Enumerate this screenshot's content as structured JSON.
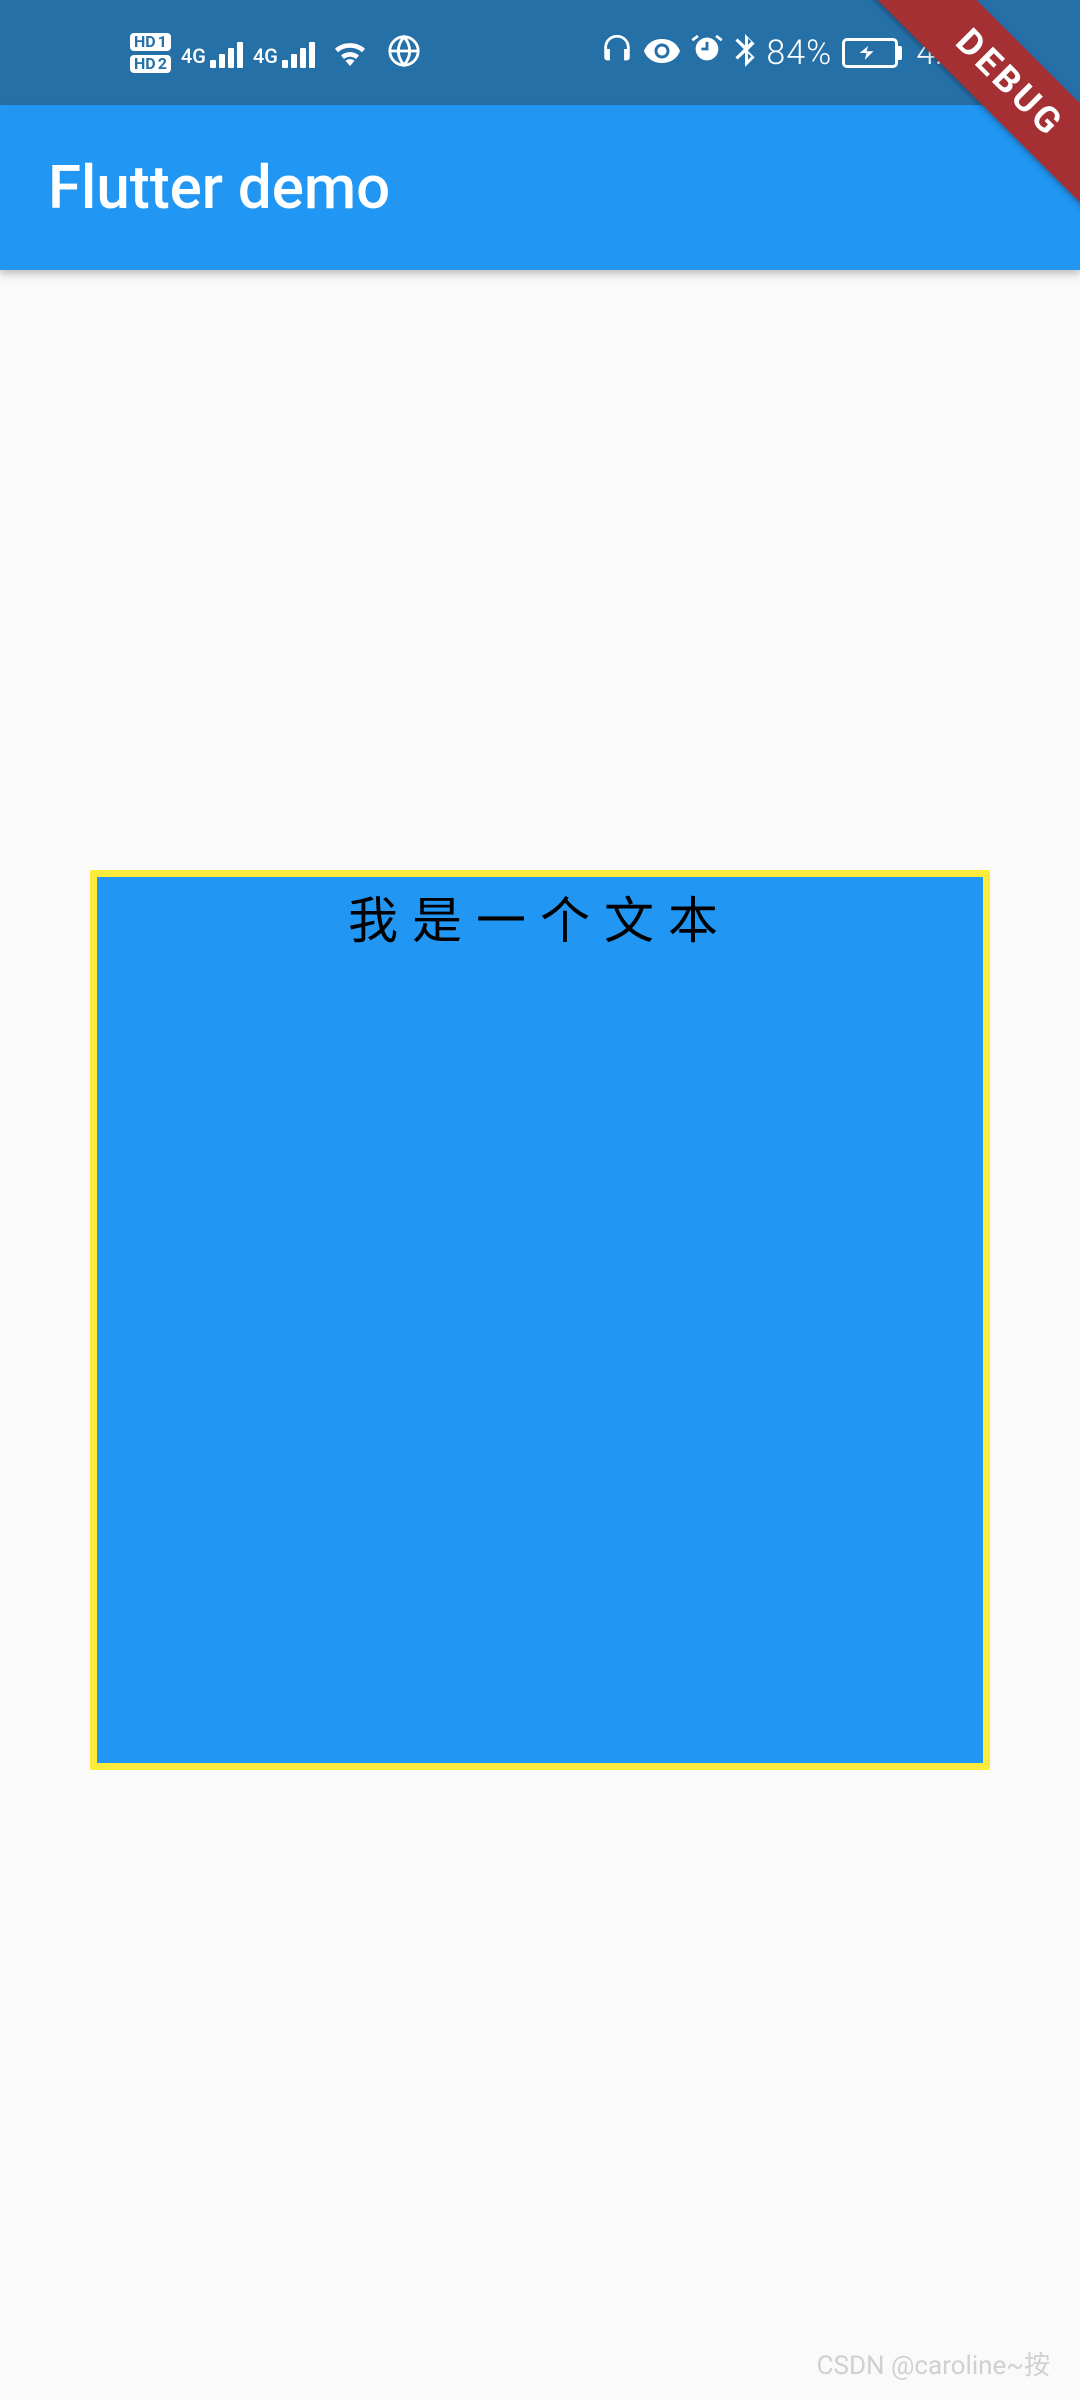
{
  "status_bar": {
    "hd1": "HD 1",
    "hd2": "HD 2",
    "signal1_label": "4G",
    "signal2_label": "4G",
    "battery_percent": "84%",
    "time": "4:02"
  },
  "app_bar": {
    "title": "Flutter demo"
  },
  "debug_banner": {
    "label": "DEBUG"
  },
  "content": {
    "box_text": "我是一个文本"
  },
  "watermark": {
    "text": "CSDN @caroline~按"
  },
  "colors": {
    "status_bar_bg": "#2670a8",
    "app_bar_bg": "#2196f3",
    "box_bg": "#2196f3",
    "box_border": "#ffeb3b",
    "debug_banner_bg": "#a53034"
  }
}
